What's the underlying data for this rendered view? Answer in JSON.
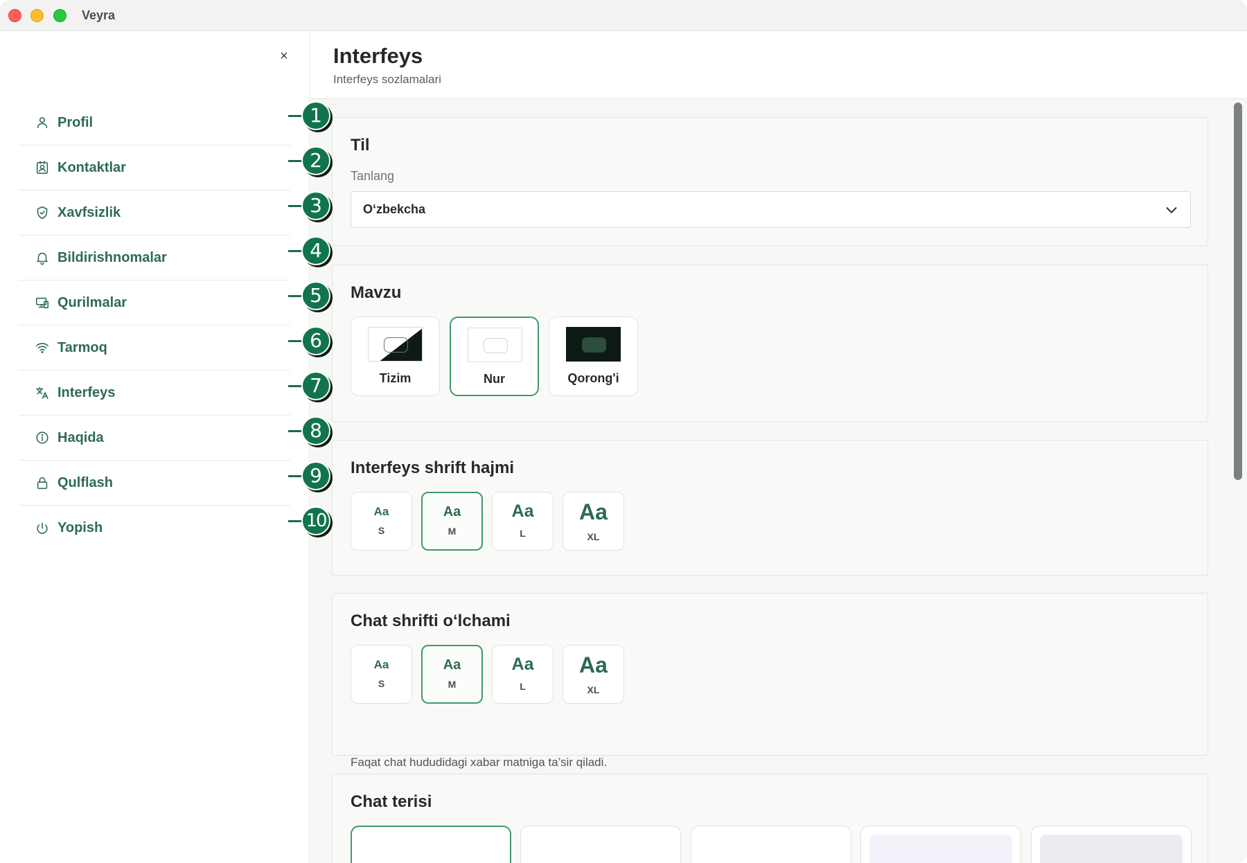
{
  "window": {
    "title": "Veyra"
  },
  "sidebar": {
    "close_label": "×",
    "items": [
      {
        "label": "Profil",
        "icon": "user-icon",
        "badge": "1"
      },
      {
        "label": "Kontaktlar",
        "icon": "contacts-icon",
        "badge": "2"
      },
      {
        "label": "Xavfsizlik",
        "icon": "shield-icon",
        "badge": "3"
      },
      {
        "label": "Bildirishnomalar",
        "icon": "bell-icon",
        "badge": "4"
      },
      {
        "label": "Qurilmalar",
        "icon": "devices-icon",
        "badge": "5"
      },
      {
        "label": "Tarmoq",
        "icon": "wifi-icon",
        "badge": "6"
      },
      {
        "label": "Interfeys",
        "icon": "translate-icon",
        "badge": "7"
      },
      {
        "label": "Haqida",
        "icon": "info-icon",
        "badge": "8"
      },
      {
        "label": "Qulflash",
        "icon": "lock-icon",
        "badge": "9"
      },
      {
        "label": "Yopish",
        "icon": "power-icon",
        "badge": "10"
      }
    ]
  },
  "header": {
    "title": "Interfeys",
    "subtitle": "Interfeys sozlamalari"
  },
  "language": {
    "title": "Til",
    "label": "Tanlang",
    "value": "O‘zbekcha"
  },
  "theme": {
    "title": "Mavzu",
    "options": [
      {
        "label": "Tizim",
        "selected": false
      },
      {
        "label": "Nur",
        "selected": true
      },
      {
        "label": "Qorong'i",
        "selected": false
      }
    ]
  },
  "ui_font": {
    "title": "Interfeys shrift hajmi",
    "sample": "Aa",
    "options": [
      {
        "code": "S",
        "selected": false
      },
      {
        "code": "M",
        "selected": true
      },
      {
        "code": "L",
        "selected": false
      },
      {
        "code": "XL",
        "selected": false
      }
    ]
  },
  "chat_font": {
    "title": "Chat shrifti o‘lchami",
    "sample": "Aa",
    "options": [
      {
        "code": "S",
        "selected": false
      },
      {
        "code": "M",
        "selected": true
      },
      {
        "code": "L",
        "selected": false
      },
      {
        "code": "XL",
        "selected": false
      }
    ],
    "note": "Faqat chat hududidagi xabar matniga ta’sir qiladi."
  },
  "chat_skin": {
    "title": "Chat terisi",
    "options": [
      {
        "selected": true,
        "tint": "#ffffff"
      },
      {
        "selected": false,
        "tint": "#ffffff"
      },
      {
        "selected": false,
        "tint": "#ffffff"
      },
      {
        "selected": false,
        "tint": "#f1f2fa"
      },
      {
        "selected": false,
        "tint": "#eaecef"
      }
    ]
  },
  "colors": {
    "accent": "#2e6b50",
    "selected_border": "#3d9a6c",
    "callout": "#12744c"
  }
}
